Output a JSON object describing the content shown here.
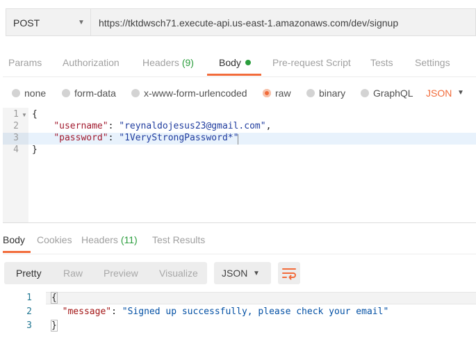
{
  "request": {
    "method": "POST",
    "url": "https://tktdwsch71.execute-api.us-east-1.amazonaws.com/dev/signup"
  },
  "tabs": {
    "params": "Params",
    "authorization": "Authorization",
    "headers": "Headers",
    "headers_count": "(9)",
    "body": "Body",
    "pre_request": "Pre-request Script",
    "tests": "Tests",
    "settings": "Settings"
  },
  "body_modes": {
    "none": "none",
    "form_data": "form-data",
    "urlencoded": "x-www-form-urlencoded",
    "raw": "raw",
    "binary": "binary",
    "graphql": "GraphQL",
    "language": "JSON"
  },
  "editor": {
    "line_numbers": [
      "1",
      "2",
      "3",
      "4"
    ],
    "open_brace": "{",
    "close_brace": "}",
    "username_key": "\"username\"",
    "username_value": "\"reynaldojesus23@gmail.com\"",
    "password_key": "\"password\"",
    "password_value": "\"1VeryStrongPassword*\""
  },
  "response_tabs": {
    "body": "Body",
    "cookies": "Cookies",
    "headers": "Headers",
    "headers_count": "(11)",
    "test_results": "Test Results"
  },
  "response_view": {
    "pretty": "Pretty",
    "raw": "Raw",
    "preview": "Preview",
    "visualize": "Visualize",
    "language": "JSON"
  },
  "response": {
    "line_numbers": [
      "1",
      "2",
      "3"
    ],
    "open_brace": "{",
    "close_brace": "}",
    "message_key": "\"message\"",
    "message_value": "\"Signed up successfully, please check your email\""
  },
  "colors": {
    "accent": "#f26b3a",
    "count_green": "#2a9d3c"
  },
  "icons": [
    "caret-down-icon",
    "fold-arrow-icon",
    "wrap-lines-icon"
  ]
}
